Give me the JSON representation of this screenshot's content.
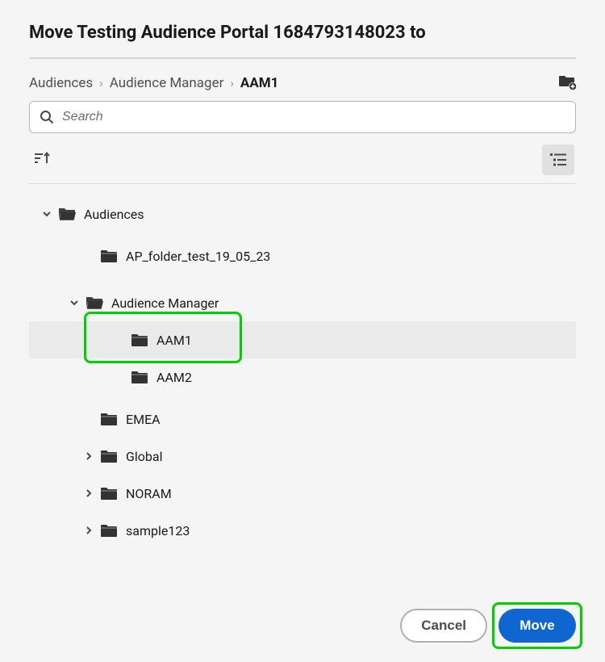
{
  "dialog": {
    "title": "Move Testing Audience Portal 1684793148023 to"
  },
  "breadcrumb": {
    "items": [
      {
        "label": "Audiences"
      },
      {
        "label": "Audience Manager"
      },
      {
        "label": "AAM1"
      }
    ]
  },
  "search": {
    "placeholder": "Search"
  },
  "tree": {
    "items": [
      {
        "label": "Audiences",
        "indent": 0,
        "expanded": true,
        "open": true,
        "hasChildren": true
      },
      {
        "label": "AP_folder_test_19_05_23",
        "indent": 1,
        "expanded": null,
        "open": false,
        "hasChildren": false
      },
      {
        "label": "Audience Manager",
        "indent": 2,
        "expanded": true,
        "open": true,
        "hasChildren": true
      },
      {
        "label": "AAM1",
        "indent": 3,
        "expanded": null,
        "open": false,
        "hasChildren": false,
        "selected": true,
        "highlighted": true
      },
      {
        "label": "AAM2",
        "indent": 3,
        "expanded": null,
        "open": false,
        "hasChildren": false
      },
      {
        "label": "EMEA",
        "indent": 1,
        "expanded": null,
        "open": false,
        "hasChildren": false
      },
      {
        "label": "Global",
        "indent": 1,
        "expanded": false,
        "open": false,
        "hasChildren": true
      },
      {
        "label": "NORAM",
        "indent": 1,
        "expanded": false,
        "open": false,
        "hasChildren": true
      },
      {
        "label": "sample123",
        "indent": 1,
        "expanded": false,
        "open": false,
        "hasChildren": true
      }
    ]
  },
  "footer": {
    "cancel_label": "Cancel",
    "move_label": "Move"
  },
  "colors": {
    "primary": "#0f66d0",
    "highlight": "#00d000"
  }
}
